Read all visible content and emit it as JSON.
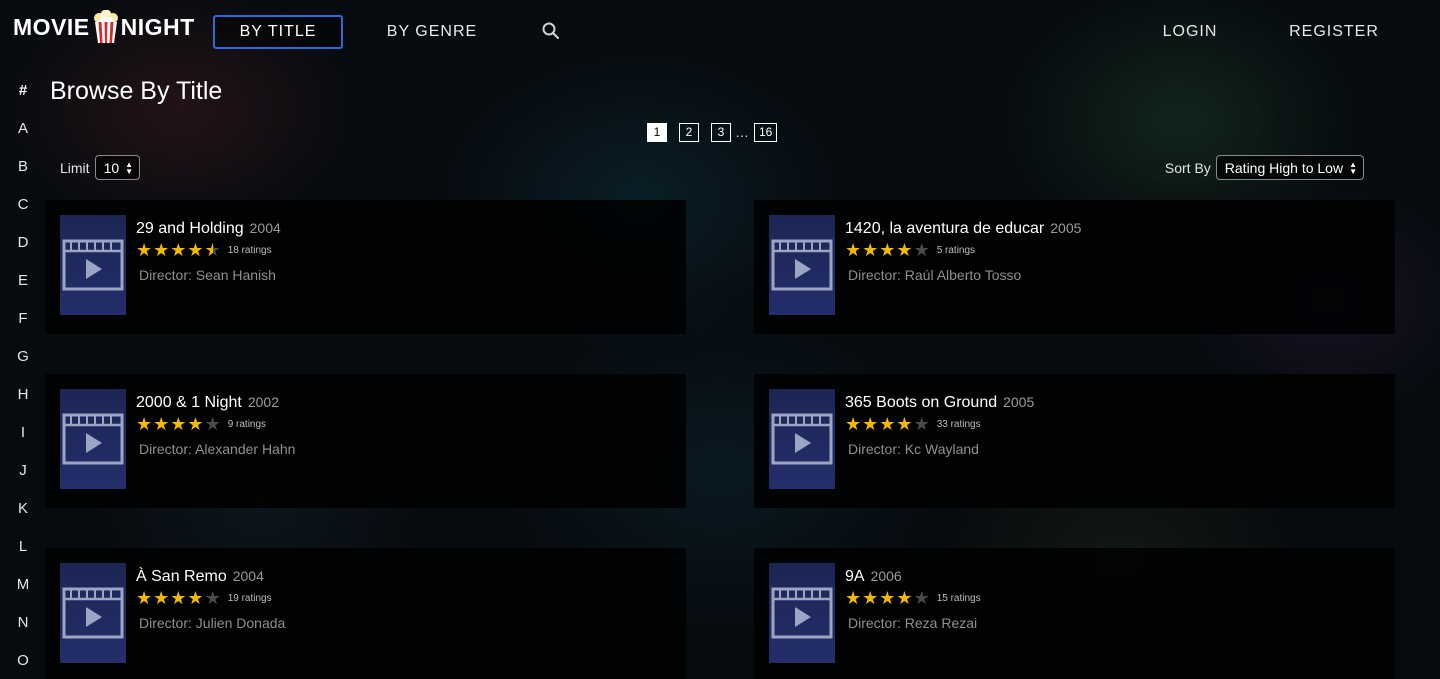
{
  "brand": {
    "word1": "MOVIE",
    "word2": "NIGHT"
  },
  "nav": {
    "tabs": [
      {
        "label": "BY TITLE",
        "active": true
      },
      {
        "label": "BY GENRE",
        "active": false
      }
    ],
    "search_icon": "search-icon",
    "login": "LOGIN",
    "register": "REGISTER"
  },
  "alphabet": [
    "#",
    "A",
    "B",
    "C",
    "D",
    "E",
    "F",
    "G",
    "H",
    "I",
    "J",
    "K",
    "L",
    "M",
    "N",
    "O"
  ],
  "page_title": "Browse By Title",
  "pagination": {
    "pages": [
      "1",
      "2",
      "3"
    ],
    "ellipsis": "…",
    "last": "16",
    "current": "1"
  },
  "limit": {
    "label": "Limit",
    "value": "10"
  },
  "sort": {
    "label": "Sort By",
    "value": "Rating High to Low"
  },
  "colors": {
    "accent": "#2e6ad6",
    "star": "#f5b800",
    "poster": "#232e6a"
  },
  "movies": [
    {
      "title": "29 and Holding",
      "year": "2004",
      "rating": 4.5,
      "ratings_text": "18 ratings",
      "director": "Director: Sean Hanish"
    },
    {
      "title": "1420, la aventura de educar",
      "year": "2005",
      "rating": 4,
      "ratings_text": "5 ratings",
      "director": "Director: Raúl Alberto Tosso"
    },
    {
      "title": "2000 & 1 Night",
      "year": "2002",
      "rating": 4,
      "ratings_text": "9 ratings",
      "director": "Director: Alexander Hahn"
    },
    {
      "title": "365 Boots on Ground",
      "year": "2005",
      "rating": 4,
      "ratings_text": "33 ratings",
      "director": "Director: Kc Wayland"
    },
    {
      "title": "À San Remo",
      "year": "2004",
      "rating": 4,
      "ratings_text": "19 ratings",
      "director": "Director: Julien Donada"
    },
    {
      "title": "9A",
      "year": "2006",
      "rating": 4,
      "ratings_text": "15 ratings",
      "director": "Director: Reza Rezai"
    }
  ]
}
